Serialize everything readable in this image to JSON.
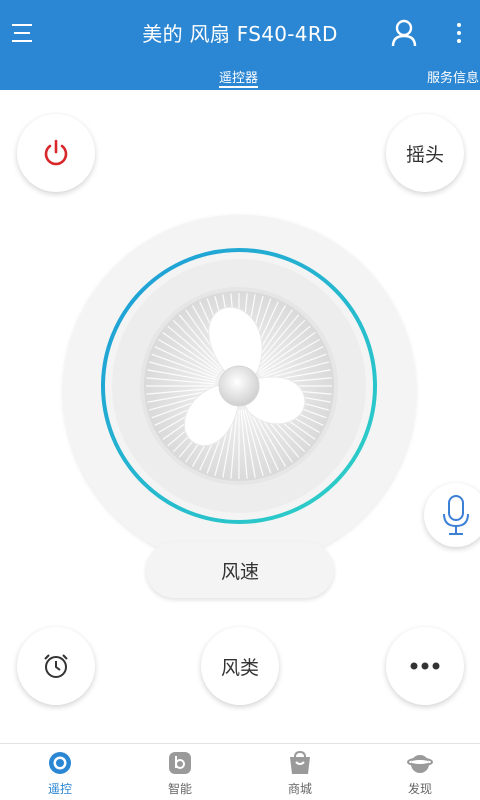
{
  "header": {
    "title": "美的 风扇 FS40-4RD",
    "menu_icon": "menu-icon",
    "user_icon": "user-icon",
    "more_icon": "more-vertical-icon",
    "background": "#2b86d3"
  },
  "tabs": [
    {
      "label": "遥控器",
      "active": true
    },
    {
      "label": "服务信息",
      "active": false
    }
  ],
  "controls": {
    "power_icon": "power-icon",
    "power_color": "#d9262a",
    "swing_label": "摇头",
    "speed_label": "风速",
    "timer_icon": "alarm-clock-icon",
    "windtype_label": "风类",
    "more_icon": "more-horizontal-icon",
    "voice_icon": "microphone-icon",
    "ring_colors": [
      "#1d9bd8",
      "#2ed3c6"
    ]
  },
  "bottom_nav": [
    {
      "label": "遥控",
      "icon": "remote-icon",
      "active": true
    },
    {
      "label": "智能",
      "icon": "smart-icon",
      "active": false
    },
    {
      "label": "商城",
      "icon": "shop-bag-icon",
      "active": false
    },
    {
      "label": "发现",
      "icon": "planet-icon",
      "active": false
    }
  ]
}
